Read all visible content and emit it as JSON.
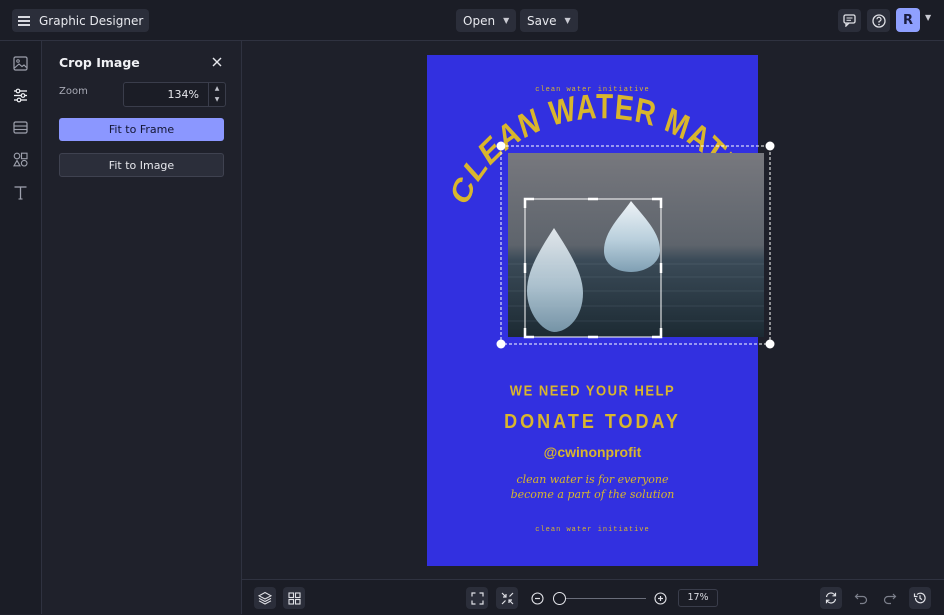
{
  "topbar": {
    "app_title": "Graphic Designer",
    "open_label": "Open",
    "save_label": "Save",
    "avatar_initial": "R"
  },
  "panel": {
    "title": "Crop Image",
    "zoom_label": "Zoom",
    "zoom_value": "134",
    "zoom_unit": "%",
    "fit_frame_label": "Fit to Frame",
    "fit_image_label": "Fit to Image"
  },
  "poster": {
    "top_small": "clean water initiative",
    "arc_title": "CLEAN WATER MATTERS",
    "help": "WE NEED YOUR HELP",
    "donate": "DONATE TODAY",
    "handle": "@cwinonprofit",
    "script_line1": "clean water is for everyone",
    "script_line2": "become a part of the solution",
    "bottom_small": "clean water initiative",
    "background_color": "#3230e0",
    "text_color": "#d9b62c"
  },
  "bottombar": {
    "zoom_value": "17",
    "zoom_unit": "%"
  },
  "colors": {
    "accent": "#8b97ff",
    "panel_bg": "#1f212b"
  }
}
